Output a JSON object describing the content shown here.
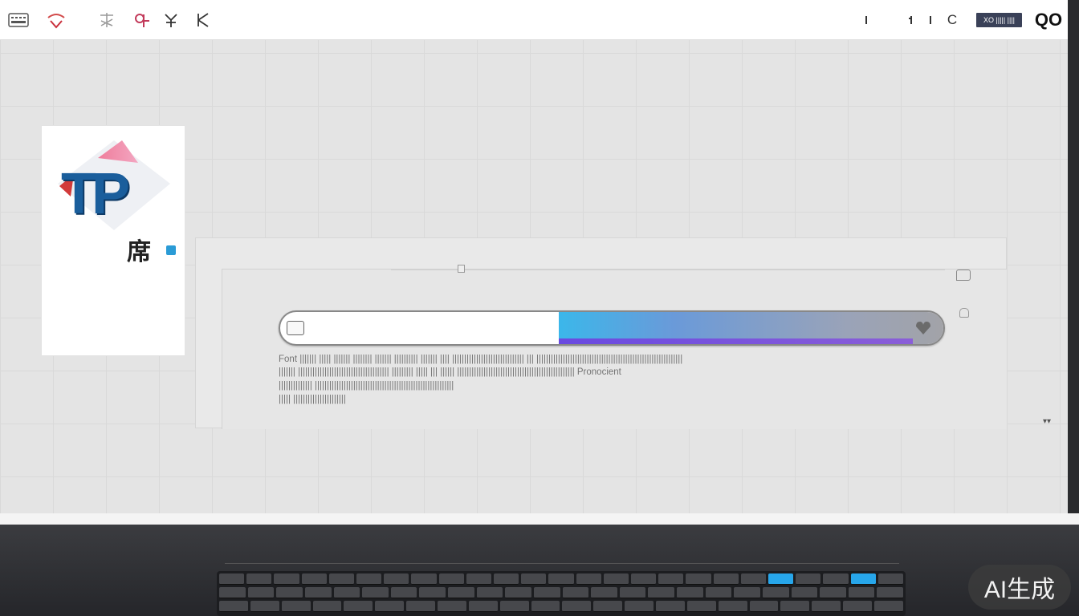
{
  "topbar": {
    "left_icons": [
      "keyboard-icon",
      "app-icon-1",
      "app-icon-2",
      "app-icon-3",
      "app-icon-4",
      "app-icon-5"
    ],
    "right_text_c": "C",
    "button_label": "XO ||||| ||||",
    "right_logo": "QO"
  },
  "logo": {
    "text": "TP",
    "cjk": "席"
  },
  "progress": {
    "value": 0.58,
    "accent": "#3bb7ea",
    "bottom_accent": "#6a4ae0"
  },
  "description": {
    "line1": "Font ||||||| ||||| ||||||| |||||||| ||||||| |||||||||| ||||||| |||| |||||||||||||||||||||||||||||| ||| |||||||||||||||||||||||||||||||||||||||||||||||||||||||||||||",
    "line2": "||||||| |||||||||||||||||||||||||||||||||||||| ||||||||| ||||| ||| |||||| ||||||||||||||||||||||||||||||||||||||||||||||||| Pronocient",
    "line3": "|||||||||||||| ||||||||||||||||||||||||||||||||||||||||||||||||||||||||||",
    "line4": "||||| ||||||||||||||||||||||"
  },
  "corner_chevrons": "▾▾",
  "keyboard": {
    "accent": "#27a6ea"
  },
  "watermark": "AI生成"
}
